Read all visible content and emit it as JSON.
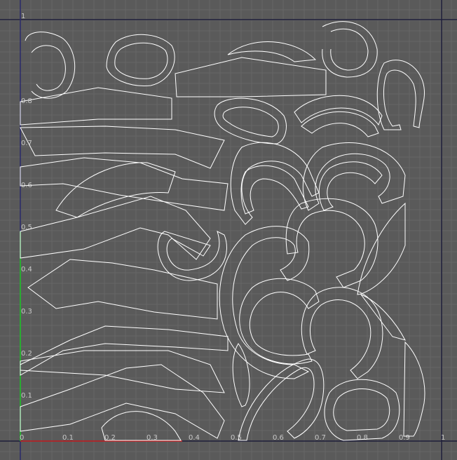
{
  "uv_editor": {
    "background_color": "#5a5a5a",
    "grid_color": "#666666",
    "boundary_color": "#222244",
    "u_axis_color": "#cc2222",
    "v_axis_color": "#22cc22",
    "wire_color": "#ffffff",
    "axis_labels": {
      "u": [
        "0",
        "0.1",
        "0.2",
        "0.3",
        "0.4",
        "0.5",
        "0.6",
        "0.7",
        "0.8",
        "0.9",
        "1"
      ],
      "v": [
        "0.1",
        "0.2",
        "0.3",
        "0.4",
        "0.5",
        "0.6",
        "0.7",
        "0.8",
        "1"
      ]
    }
  }
}
